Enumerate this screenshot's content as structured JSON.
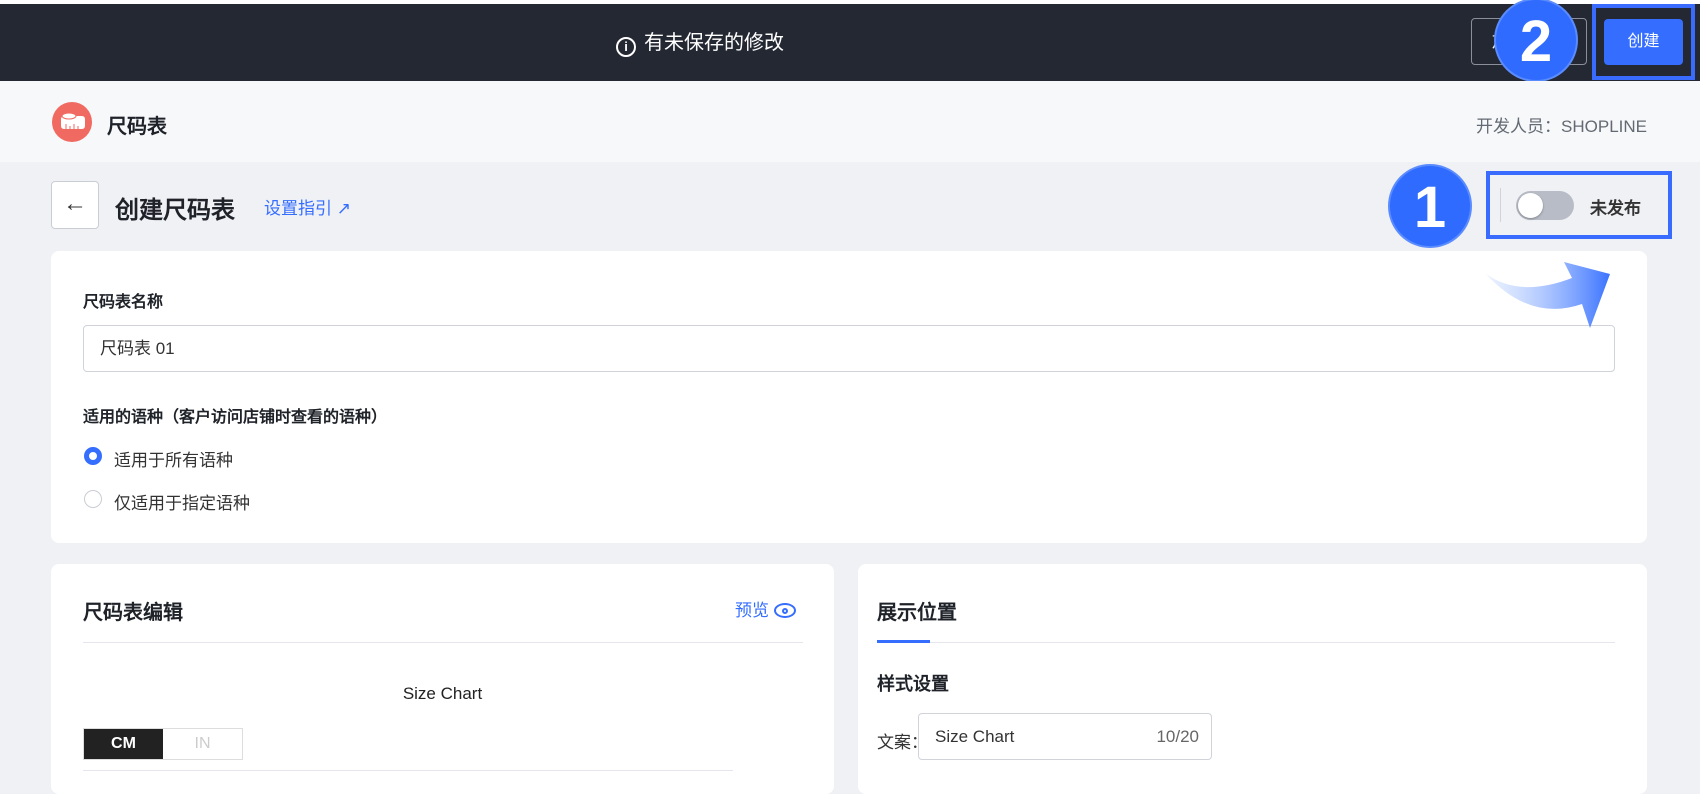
{
  "topbar": {
    "notice": "有未保存的修改",
    "discard_label": "放弃",
    "create_label": "创建"
  },
  "annotations": {
    "step1": "1",
    "step2": "2"
  },
  "header": {
    "app_name": "尺码表",
    "developer": "开发人员：SHOPLINE"
  },
  "page": {
    "title": "创建尺码表",
    "guide_link": "设置指引",
    "publish_status": "未发布",
    "published": false
  },
  "basic": {
    "name_label": "尺码表名称",
    "name_value": "尺码表 01",
    "lang_label": "适用的语种（客户访问店铺时查看的语种）",
    "options": [
      "适用于所有语种",
      "仅适用于指定语种"
    ],
    "selected": 0
  },
  "editor": {
    "title": "尺码表编辑",
    "preview": "预览",
    "chart_title": "Size Chart",
    "units": [
      "CM",
      "IN"
    ]
  },
  "display": {
    "tab": "展示位置",
    "style_heading": "样式设置",
    "text_label": "文案：",
    "text_value": "Size Chart",
    "counter": "10/20"
  }
}
